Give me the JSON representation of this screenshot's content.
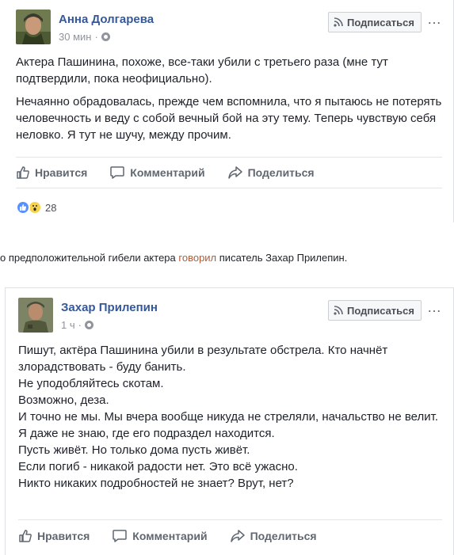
{
  "post1": {
    "author": "Анна Долгарева",
    "time": "30 мин",
    "subscribe_label": "Подписаться",
    "more_icon": "…",
    "paragraphs": [
      "Актера Пашинина, похоже, все-таки убили с третьего раза (мне тут подтвердили, пока неофициально).",
      "Нечаянно обрадовалась, прежде чем вспомнила, что я пытаюсь не потерять человечность и веду с собой вечный бой на эту тему. Теперь чувствую себя неловко. Я тут не шучу, между прочим."
    ],
    "like_label": "Нравится",
    "comment_label": "Комментарий",
    "share_label": "Поделиться",
    "reactions_count": "28"
  },
  "caption": {
    "before": "о предположительной гибели актера ",
    "link": "говорил",
    "after": " писатель Захар Прилепин."
  },
  "post2": {
    "author": "Захар Прилепин",
    "time": "1 ч",
    "subscribe_label": "Подписаться",
    "more_icon": "…",
    "lines": [
      "Пишут, актёра Пашинина убили в результате обстрела. Кто начнёт злорадствовать - буду банить.",
      "Не уподобляйтесь скотам.",
      "Возможно, деза.",
      "И точно не мы. Мы вчера вообще никуда не стреляли, начальство не велит.",
      "Я даже не знаю, где его подраздел находится.",
      "Пусть живёт. Но только дома пусть живёт.",
      "Если погиб - никакой радости нет. Это всё ужасно.",
      "Никто никаких подробностей не знает? Врут, нет?"
    ],
    "like_label": "Нравится",
    "comment_label": "Комментарий",
    "share_label": "Поделиться"
  },
  "colors": {
    "author": "#365899",
    "muted": "#90949c",
    "link": "#b35a33"
  }
}
